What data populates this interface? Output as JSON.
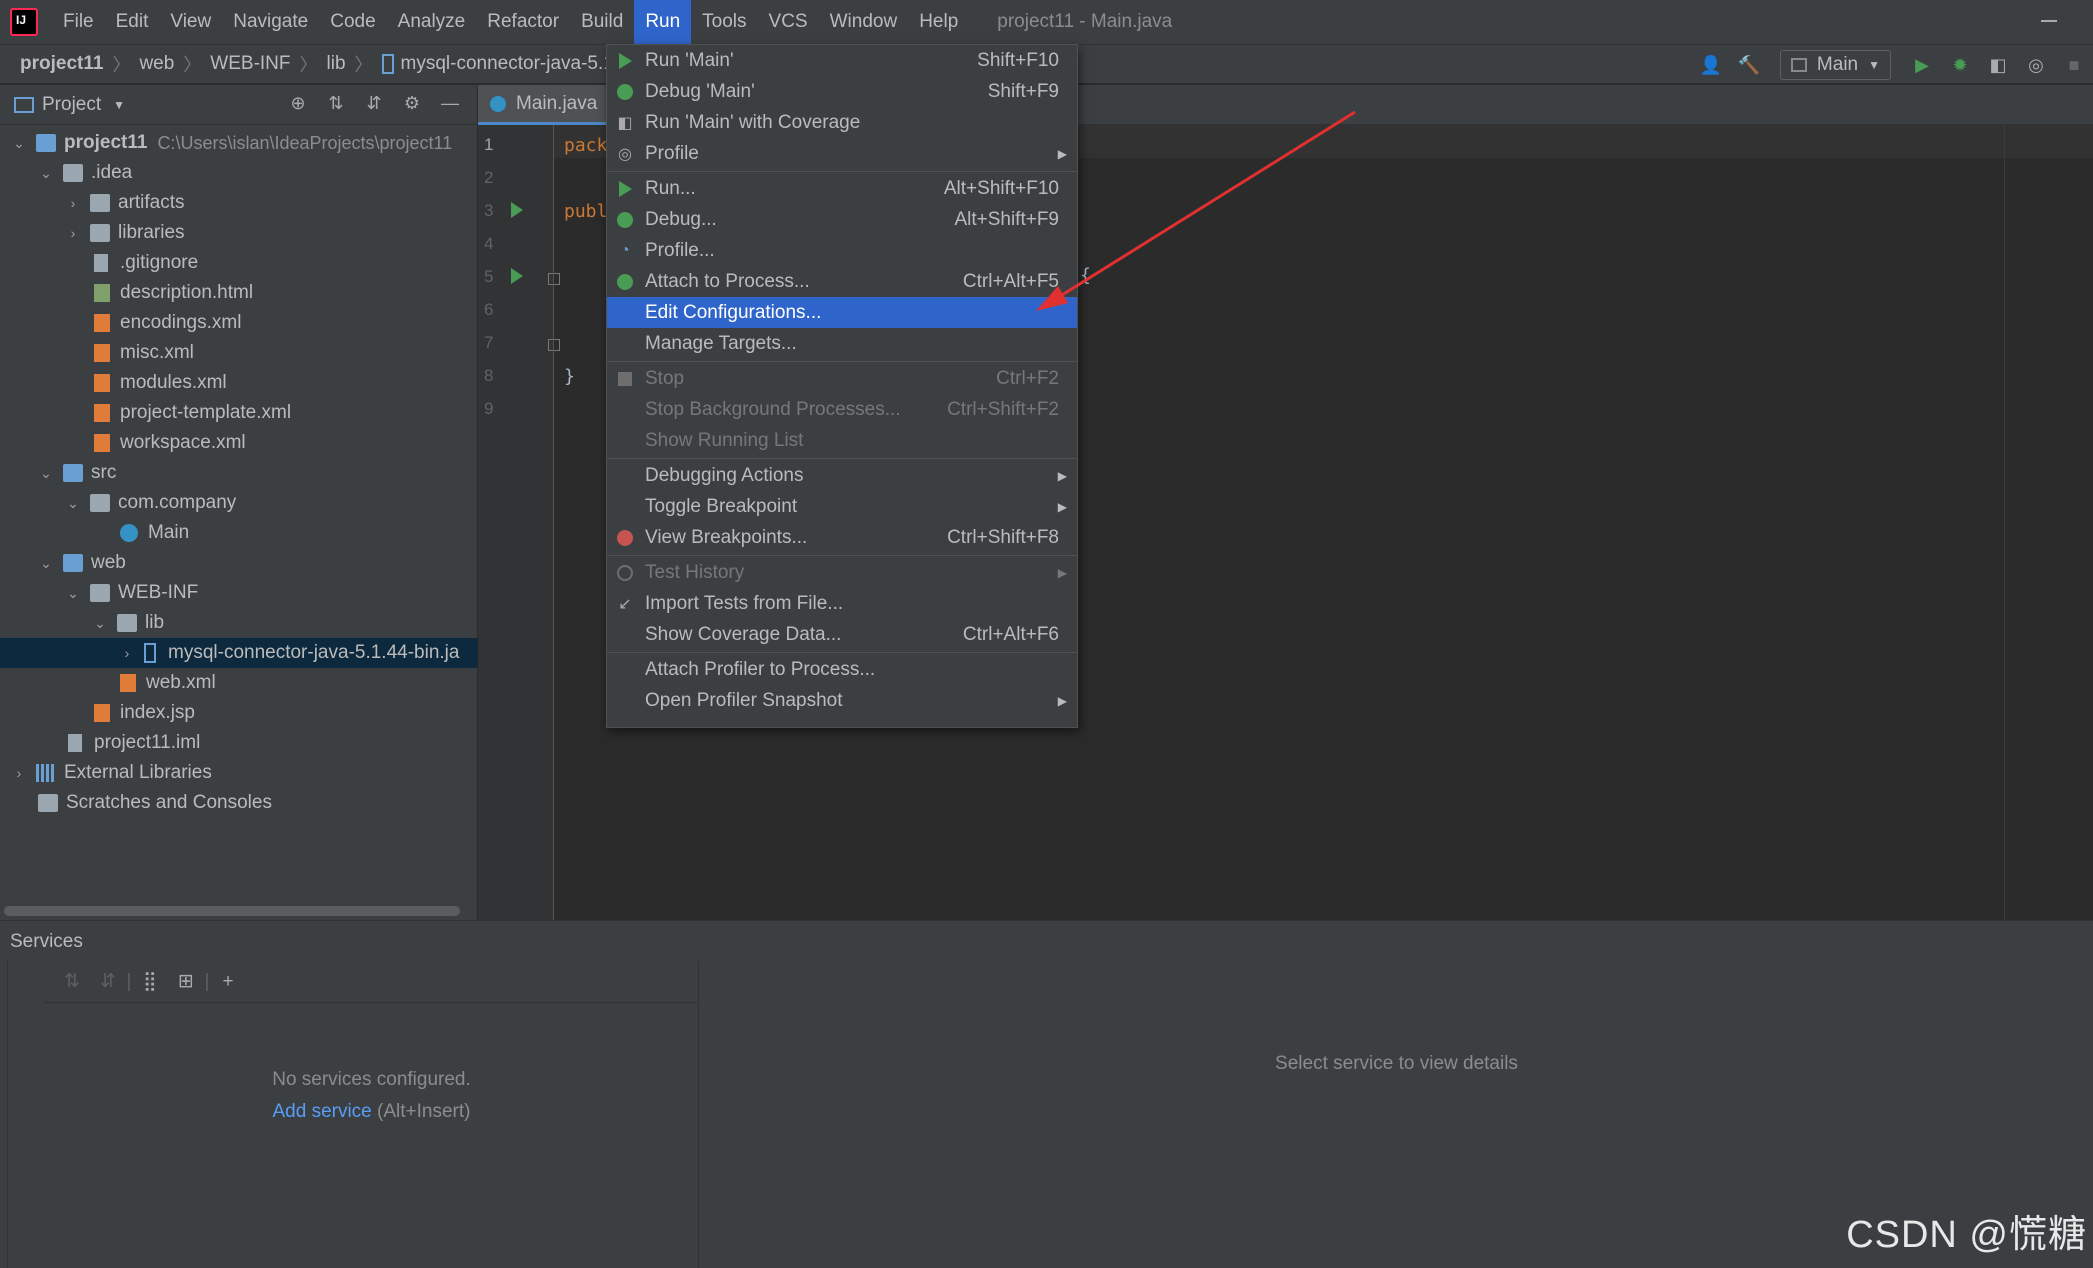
{
  "menubar": {
    "items": [
      "File",
      "Edit",
      "View",
      "Navigate",
      "Code",
      "Analyze",
      "Refactor",
      "Build",
      "Run",
      "Tools",
      "VCS",
      "Window",
      "Help"
    ],
    "active": "Run",
    "window_title": "project11 - Main.java"
  },
  "breadcrumb": [
    "project11",
    "web",
    "WEB-INF",
    "lib",
    "mysql-connector-java-5.1.44"
  ],
  "toolbar": {
    "run_config": "Main"
  },
  "project_panel": {
    "title": "Project",
    "tree": [
      {
        "label": "project11",
        "hint": "C:\\Users\\islan\\IdeaProjects\\project11"
      },
      {
        "label": ".idea"
      },
      {
        "label": "artifacts"
      },
      {
        "label": "libraries"
      },
      {
        "label": ".gitignore"
      },
      {
        "label": "description.html"
      },
      {
        "label": "encodings.xml"
      },
      {
        "label": "misc.xml"
      },
      {
        "label": "modules.xml"
      },
      {
        "label": "project-template.xml"
      },
      {
        "label": "workspace.xml"
      },
      {
        "label": "src"
      },
      {
        "label": "com.company"
      },
      {
        "label": "Main"
      },
      {
        "label": "web"
      },
      {
        "label": "WEB-INF"
      },
      {
        "label": "lib"
      },
      {
        "label": "mysql-connector-java-5.1.44-bin.ja"
      },
      {
        "label": "web.xml"
      },
      {
        "label": "index.jsp"
      },
      {
        "label": "project11.iml"
      },
      {
        "label": "External Libraries"
      },
      {
        "label": "Scratches and Consoles"
      }
    ]
  },
  "editor": {
    "tab": "Main.java",
    "line_numbers": [
      "1",
      "2",
      "3",
      "4",
      "5",
      "6",
      "7",
      "8",
      "9"
    ],
    "code_fragments": {
      "line1": "pack",
      "line3": "publ",
      "line5_brace": "{",
      "line8": "}"
    }
  },
  "run_menu": {
    "items": [
      {
        "label": "Run 'Main'",
        "shortcut": "Shift+F10",
        "icon": "run-icon"
      },
      {
        "label": "Debug 'Main'",
        "shortcut": "Shift+F9",
        "icon": "debug-icon"
      },
      {
        "label": "Run 'Main' with Coverage",
        "shortcut": "",
        "icon": "coverage-icon"
      },
      {
        "label": "Profile",
        "shortcut": "",
        "icon": "profile-icon",
        "submenu": true
      },
      {
        "label": "Run...",
        "shortcut": "Alt+Shift+F10",
        "icon": "run-icon"
      },
      {
        "label": "Debug...",
        "shortcut": "Alt+Shift+F9",
        "icon": "debug-icon"
      },
      {
        "label": "Profile...",
        "shortcut": "",
        "icon": "profiler-gauge-icon"
      },
      {
        "label": "Attach to Process...",
        "shortcut": "Ctrl+Alt+F5",
        "icon": "attach-icon"
      },
      {
        "label": "Edit Configurations...",
        "shortcut": "",
        "highlighted": true
      },
      {
        "label": "Manage Targets...",
        "shortcut": ""
      },
      {
        "label": "Stop",
        "shortcut": "Ctrl+F2",
        "icon": "stop-icon",
        "disabled": true
      },
      {
        "label": "Stop Background Processes...",
        "shortcut": "Ctrl+Shift+F2",
        "disabled": true
      },
      {
        "label": "Show Running List",
        "shortcut": "",
        "disabled": true
      },
      {
        "label": "Debugging Actions",
        "shortcut": "",
        "submenu": true
      },
      {
        "label": "Toggle Breakpoint",
        "shortcut": "",
        "submenu": true
      },
      {
        "label": "View Breakpoints...",
        "shortcut": "Ctrl+Shift+F8",
        "icon": "breakpoint-icon"
      },
      {
        "label": "Test History",
        "shortcut": "",
        "icon": "history-icon",
        "disabled": true,
        "submenu": true
      },
      {
        "label": "Import Tests from File...",
        "shortcut": "",
        "icon": "import-icon"
      },
      {
        "label": "Show Coverage Data...",
        "shortcut": "Ctrl+Alt+F6"
      },
      {
        "label": "Attach Profiler to Process...",
        "shortcut": ""
      },
      {
        "label": "Open Profiler Snapshot",
        "shortcut": "",
        "submenu": true
      }
    ]
  },
  "services": {
    "title": "Services",
    "empty_text": "No services configured.",
    "add_link": "Add service",
    "add_hint": "(Alt+Insert)",
    "details_text": "Select service to view details"
  },
  "watermark": "CSDN @慌糖",
  "colors": {
    "accent": "#2f65ca",
    "annotation": "#e03030",
    "run_green": "#499c54"
  }
}
